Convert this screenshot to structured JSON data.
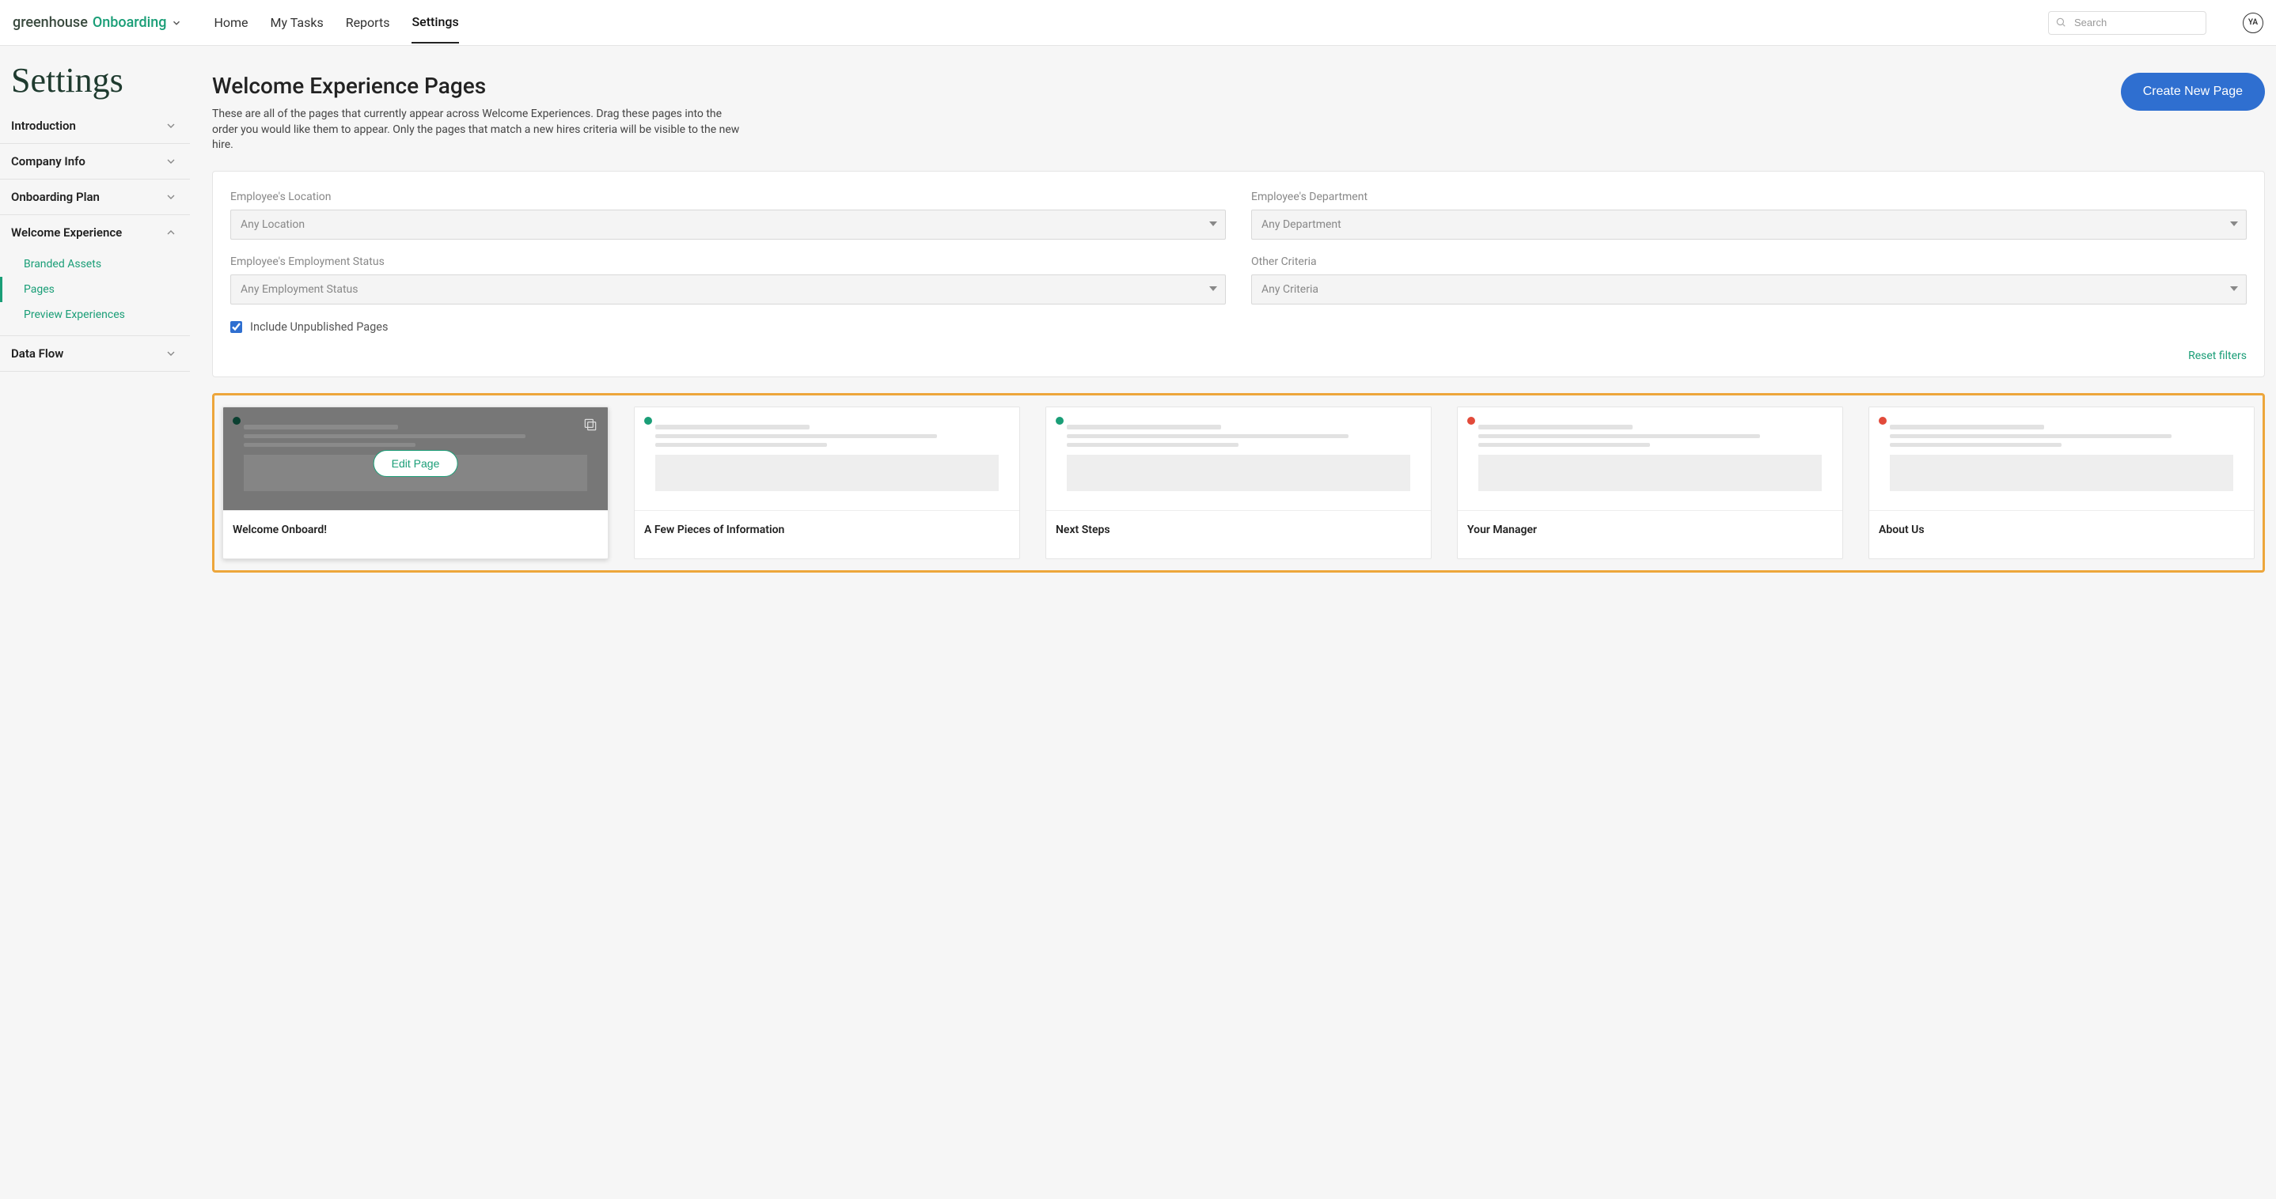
{
  "brand": {
    "part1": "greenhouse",
    "part2": "Onboarding"
  },
  "nav": {
    "items": [
      {
        "label": "Home"
      },
      {
        "label": "My Tasks"
      },
      {
        "label": "Reports"
      },
      {
        "label": "Settings"
      }
    ],
    "active_index": 3
  },
  "search": {
    "placeholder": "Search"
  },
  "avatar": "YA",
  "page_title": "Settings",
  "sidebar": {
    "sections": [
      {
        "label": "Introduction",
        "expanded": false
      },
      {
        "label": "Company Info",
        "expanded": false
      },
      {
        "label": "Onboarding Plan",
        "expanded": false
      },
      {
        "label": "Welcome Experience",
        "expanded": true,
        "items": [
          {
            "label": "Branded Assets"
          },
          {
            "label": "Pages",
            "active": true
          },
          {
            "label": "Preview Experiences"
          }
        ]
      },
      {
        "label": "Data Flow",
        "expanded": false
      }
    ]
  },
  "main": {
    "title": "Welcome Experience Pages",
    "desc": "These are all of the pages that currently appear across Welcome Experiences. Drag these pages into the order you would like them to appear. Only the pages that match a new hires criteria will be visible to the new hire.",
    "create_label": "Create New Page"
  },
  "filters": {
    "f1_label": "Employee's Location",
    "f1_placeholder": "Any Location",
    "f2_label": "Employee's Department",
    "f2_placeholder": "Any Department",
    "f3_label": "Employee's Employment Status",
    "f3_placeholder": "Any Employment Status",
    "f4_label": "Other Criteria",
    "f4_placeholder": "Any Criteria",
    "include_label": "Include Unpublished Pages",
    "include_checked": true,
    "reset_label": "Reset filters"
  },
  "pages": [
    {
      "title": "Welcome Onboard!",
      "status": "dgreen",
      "hovered": true,
      "edit_label": "Edit Page"
    },
    {
      "title": "A Few Pieces of Information",
      "status": "green"
    },
    {
      "title": "Next Steps",
      "status": "green"
    },
    {
      "title": "Your Manager",
      "status": "red"
    },
    {
      "title": "About Us",
      "status": "red"
    }
  ]
}
